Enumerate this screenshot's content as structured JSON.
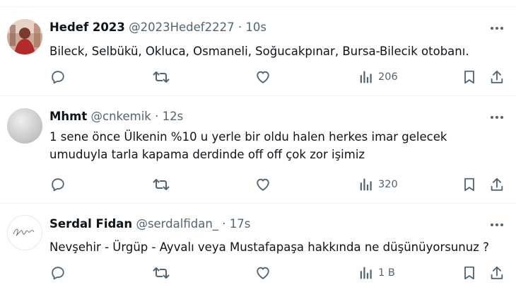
{
  "tweets": [
    {
      "name": "Hedef 2023",
      "handle": "@2023Hedef2227",
      "separator": "·",
      "time": "10s",
      "text_lines": [
        "Bileck, Selbükü, Okluca,  Osmaneli, Soğucakpınar, Bursa-Bilecik otobanı."
      ],
      "views": "206",
      "avatar": "photo-avatar"
    },
    {
      "name": "Mhmt",
      "handle": "@cnkemik",
      "separator": "·",
      "time": "12s",
      "text_lines": [
        "1 sene önce Ülkenin %10 u yerle bir oldu halen herkes  imar gelecek",
        "umuduyla tarla kapama derdinde off off çok zor işimiz"
      ],
      "views": "320",
      "avatar": "default-grey-avatar"
    },
    {
      "name": "Serdal Fidan",
      "handle": "@serdalfidan_",
      "separator": "·",
      "time": "17s",
      "text_lines": [
        "Nevşehir - Ürgüp - Ayvalı veya Mustafapaşa hakkında ne düşünüyorsunuz ?"
      ],
      "views": "1 B",
      "avatar": "signature-avatar"
    }
  ],
  "icons": [
    "more-icon",
    "reply-icon",
    "retweet-icon",
    "like-icon",
    "views-icon",
    "bookmark-icon",
    "share-icon"
  ],
  "colors": {
    "text": "#0f1419",
    "secondary": "#536471",
    "divider": "#eff3f4"
  }
}
